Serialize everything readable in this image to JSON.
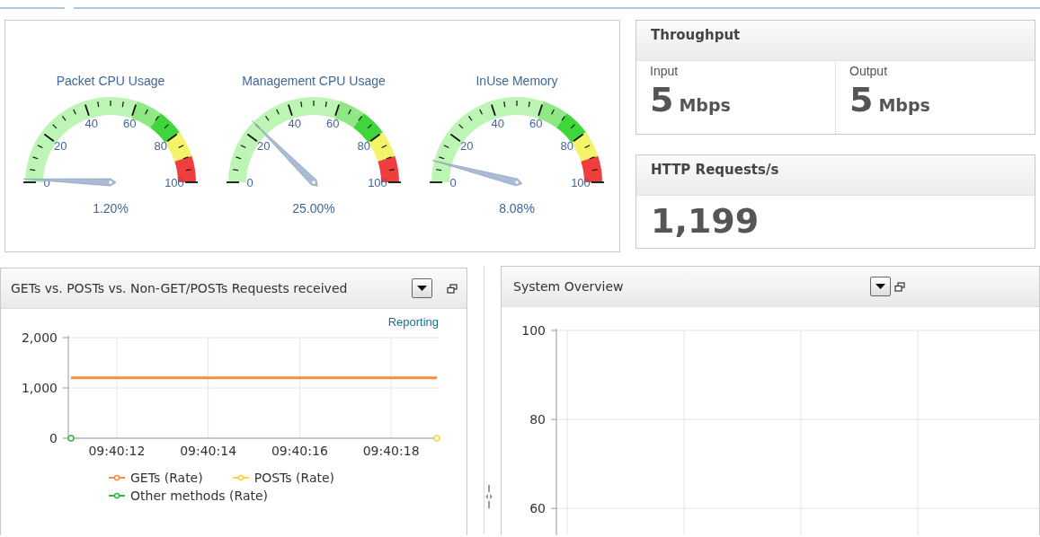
{
  "gauges": [
    {
      "title": "Packet CPU Usage",
      "scale": [
        "0",
        "20",
        "40",
        "60",
        "80",
        "100"
      ],
      "reading": "1.20%"
    },
    {
      "title": "Management CPU Usage",
      "scale": [
        "0",
        "20",
        "40",
        "60",
        "80",
        "100"
      ],
      "reading": "25.00%"
    },
    {
      "title": "InUse Memory",
      "scale": [
        "0",
        "20",
        "40",
        "60",
        "80",
        "100"
      ],
      "reading": "8.08%"
    }
  ],
  "throughput": {
    "title": "Throughput",
    "metrics": [
      {
        "label": "Input",
        "value": "5",
        "unit": "Mbps"
      },
      {
        "label": "Output",
        "value": "5",
        "unit": "Mbps"
      }
    ]
  },
  "http_requests": {
    "title": "HTTP Requests/s",
    "value": "1,199"
  },
  "panels": [
    {
      "title": "GETs vs. POSTs vs. Non-GET/POSTs Requests received",
      "link": "Reporting",
      "chart_data": {
        "type": "line",
        "categories": [
          null,
          "09:40:12",
          null,
          "09:40:14",
          null,
          "09:40:16",
          null,
          "09:40:18",
          null
        ],
        "ylim": [
          0,
          2000
        ],
        "grid": true,
        "yticks": [
          {
            "value": 0,
            "label": "0"
          },
          {
            "value": 1000,
            "label": "1,000"
          },
          {
            "value": 2000,
            "label": "2,000"
          }
        ],
        "series": [
          {
            "name": "GETs (Rate)",
            "color": "#ff8c3c",
            "marker": "none",
            "values": [
              1200,
              1200,
              1200,
              1200,
              1200,
              1200,
              1200,
              1200,
              1200
            ]
          },
          {
            "name": "POSTs (Rate)",
            "color": "#ffd23c",
            "marker": "circle",
            "values": [
              null,
              null,
              null,
              null,
              null,
              null,
              null,
              null,
              0
            ]
          },
          {
            "name": "Other methods (Rate)",
            "color": "#2eb84a",
            "marker": "circle",
            "values": [
              0,
              null,
              null,
              null,
              null,
              null,
              null,
              null,
              null
            ]
          }
        ]
      }
    },
    {
      "title": "System Overview",
      "chart_data": {
        "type": "line",
        "categories": [
          null,
          null,
          null,
          null
        ],
        "yticks": [
          60,
          80,
          100
        ],
        "ylim": [
          54,
          100
        ],
        "grid": true
      }
    }
  ]
}
